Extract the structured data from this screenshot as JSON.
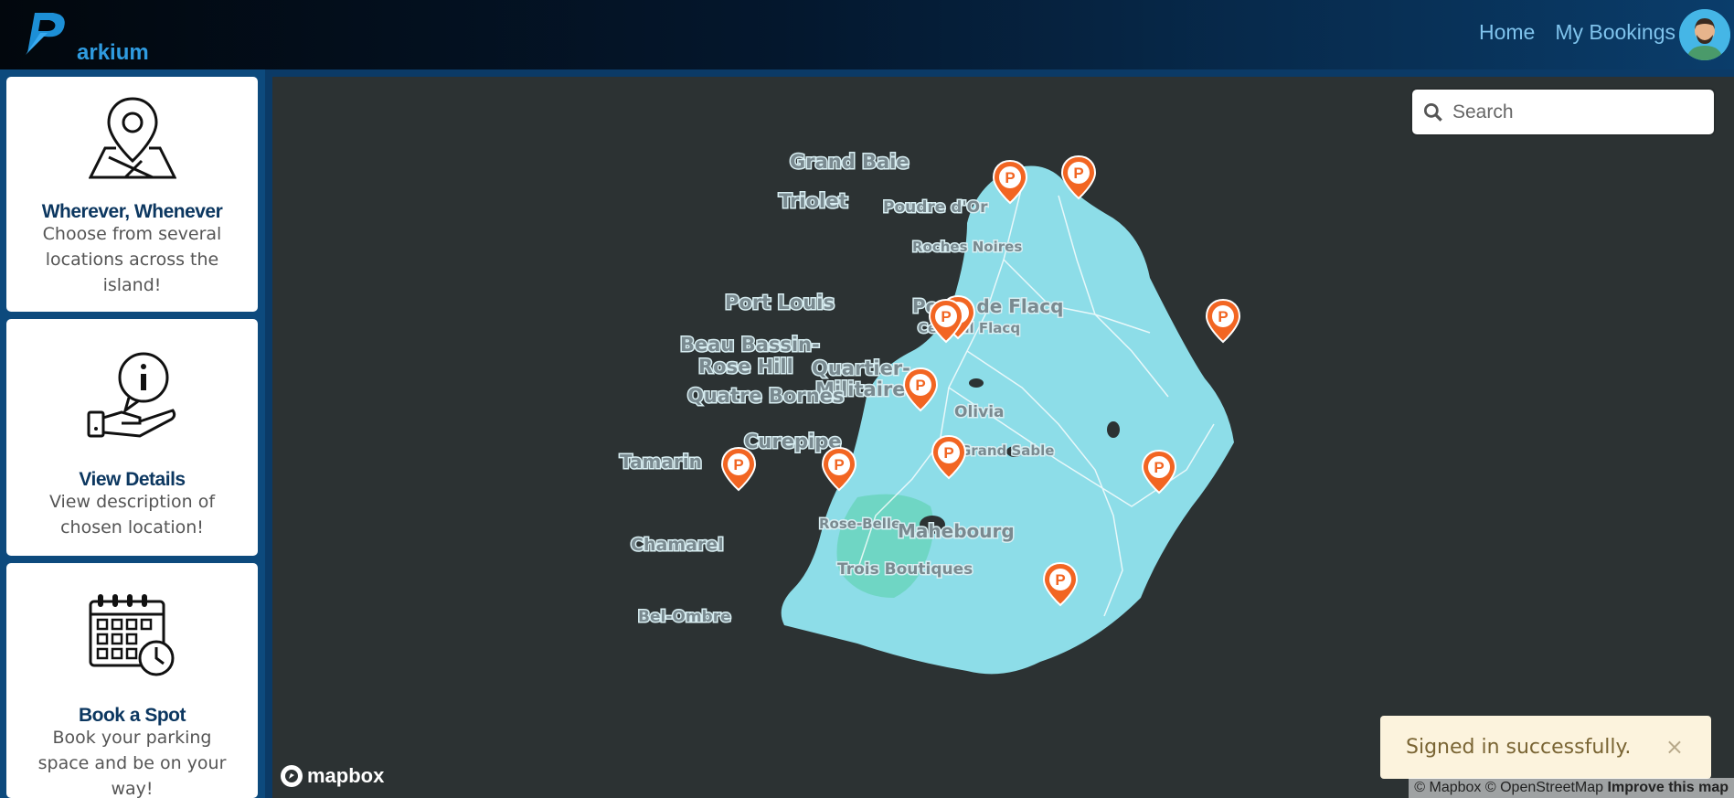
{
  "app": {
    "logo_letter": "P",
    "logo_text": "arkium"
  },
  "nav": {
    "home": "Home",
    "bookings": "My Bookings"
  },
  "cards": [
    {
      "title": "Wherever, Whenever",
      "desc": "Choose from several locations across the island!",
      "icon": "map-pin-icon"
    },
    {
      "title": "View Details",
      "desc": "View description of chosen location!",
      "icon": "info-hand-icon"
    },
    {
      "title": "Book a Spot",
      "desc": "Book your parking space and be on your way!",
      "icon": "calendar-clock-icon"
    }
  ],
  "map": {
    "search_placeholder": "Search",
    "places": {
      "grand_baie": "Grand Baie",
      "triolet": "Triolet",
      "poudre": "Poudre d'Or",
      "roches": "Roches Noires",
      "port_louis": "Port Louis",
      "poste": "Poste de Flacq",
      "central": "Central Flacq",
      "beau": "Beau Bassin-",
      "rose": "Rose Hill",
      "quartier1": "Quartier-",
      "quartier2": "Militaire",
      "quatre": "Quatre Bornes",
      "olivia": "Olivia",
      "curepipe": "Curepipe",
      "tamarin": "Tamarin",
      "grand_sable": "Grand Sable",
      "rose_belle": "Rose-Belle",
      "mahebourg": "Mahebourg",
      "chamarel": "Chamarel",
      "trois": "Trois Boutiques",
      "bel_ombre": "Bel-Ombre"
    },
    "pin_label": "P",
    "mapbox_label": "mapbox",
    "attribution": "© Mapbox © OpenStreetMap",
    "improve": "Improve this map"
  },
  "toast": {
    "message": "Signed in successfully.",
    "close": "×"
  },
  "colors": {
    "land": "#8ddde8",
    "water": "#2c3233",
    "pin": "#f26522",
    "nav_link": "#7fc3ec",
    "card_title": "#0c3760"
  }
}
